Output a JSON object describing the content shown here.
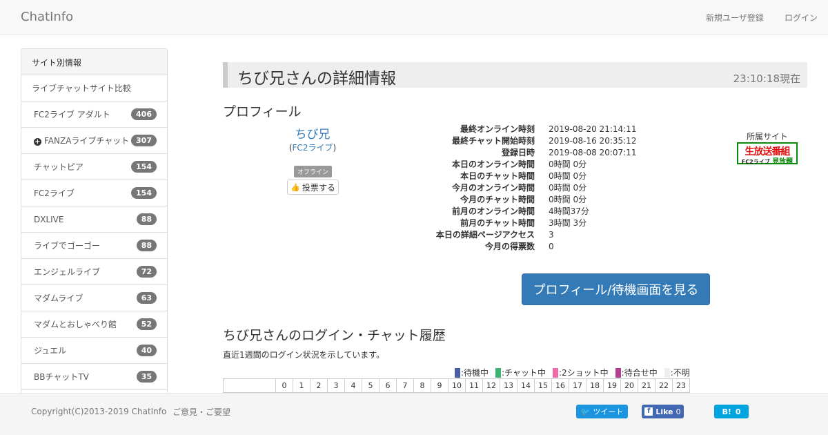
{
  "navbar": {
    "brand": "ChatInfo",
    "register": "新規ユーザ登録",
    "login": "ログイン"
  },
  "sidebar": {
    "header": "サイト別情報",
    "compare": "ライブチャットサイト比較",
    "items": [
      {
        "label": "FC2ライブ アダルト",
        "count": "406"
      },
      {
        "label": "FANZAライブチャット",
        "count": "307",
        "icon": "plus-circle-icon"
      },
      {
        "label": "チャットピア",
        "count": "154"
      },
      {
        "label": "FC2ライブ",
        "count": "154"
      },
      {
        "label": "DXLIVE",
        "count": "88"
      },
      {
        "label": "ライブでゴーゴー",
        "count": "88"
      },
      {
        "label": "エンジェルライブ",
        "count": "72"
      },
      {
        "label": "マダムライブ",
        "count": "63"
      },
      {
        "label": "マダムとおしゃべり館",
        "count": "52"
      },
      {
        "label": "ジュエル",
        "count": "40"
      },
      {
        "label": "BBチャットTV",
        "count": "35"
      }
    ]
  },
  "main": {
    "title": "ちび兄さんの詳細情報",
    "time": "23:10:18現在",
    "profile_heading": "プロフィール",
    "user": {
      "name": "ちび兄",
      "site_open": "(",
      "site": "FC2ライブ",
      "site_close": ")",
      "status": "オフライン",
      "vote": "投票する"
    },
    "stats": [
      {
        "label": "最終オンライン時刻",
        "value": "2019-08-20 21:14:11"
      },
      {
        "label": "最終チャット開始時刻",
        "value": "2019-08-16 20:35:12"
      },
      {
        "label": "登録日時",
        "value": "2019-08-08 20:07:11"
      },
      {
        "label": "本日のオンライン時間",
        "value": "0時間 0分"
      },
      {
        "label": "本日のチャット時間",
        "value": "0時間 0分"
      },
      {
        "label": "今月のオンライン時間",
        "value": "0時間 0分"
      },
      {
        "label": "今月のチャット時間",
        "value": "0時間 0分"
      },
      {
        "label": "前月のオンライン時間",
        "value": "4時間37分"
      },
      {
        "label": "前月のチャット時間",
        "value": "3時間 3分"
      },
      {
        "label": "本日の詳細ページアクセス",
        "value": "3"
      },
      {
        "label": "今月の得票数",
        "value": "0"
      }
    ],
    "affiliation_label": "所属サイト",
    "logo": {
      "top": "生放送番組",
      "bottom_small": "FC2ライブ",
      "bottom": "見放題"
    },
    "profile_button": "プロフィール/待機画面を見る",
    "history_heading": "ちび兄さんのログイン・チャット履歴",
    "history_desc": "直近1週間のログイン状況を示しています。",
    "legend": [
      {
        "label": ":待機中",
        "color": "#4a5fa8"
      },
      {
        "label": ":チャット中",
        "color": "#3cb371"
      },
      {
        "label": ":2ショット中",
        "color": "#f06aa8"
      },
      {
        "label": ":待合せ中",
        "color": "#b0418f"
      },
      {
        "label": ":不明",
        "color": "#eeeeee"
      }
    ],
    "hours": [
      "0",
      "1",
      "2",
      "3",
      "4",
      "5",
      "6",
      "7",
      "8",
      "9",
      "10",
      "11",
      "12",
      "13",
      "14",
      "15",
      "16",
      "17",
      "18",
      "19",
      "20",
      "21",
      "22",
      "23"
    ]
  },
  "footer": {
    "copyright": "Copyright(C)2013-2019 ChatInfo",
    "feedback": "ご意見・ご要望",
    "tweet": "ツイート",
    "like": "Like",
    "like_count": "0",
    "hatena": "B!",
    "hatena_count": "0"
  }
}
